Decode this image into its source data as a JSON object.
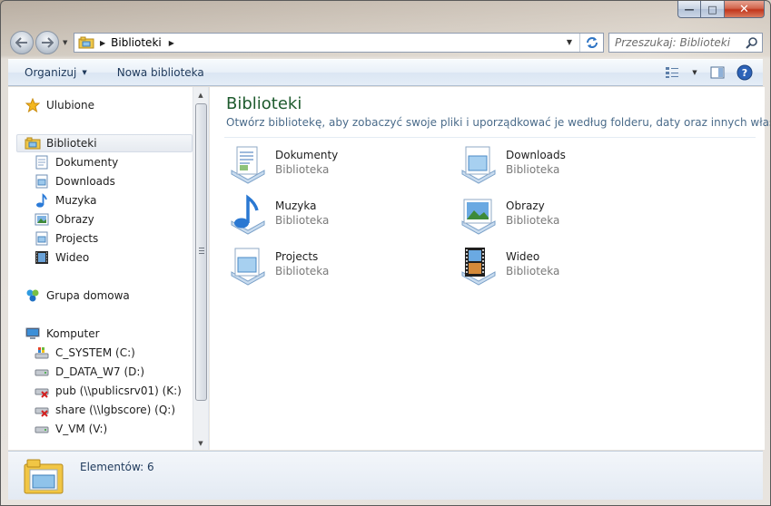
{
  "window": {
    "caption_buttons": {
      "minimize": "—",
      "maximize": "□",
      "close": "✕"
    }
  },
  "address_bar": {
    "breadcrumbs": [
      "Biblioteki"
    ],
    "search_placeholder": "Przeszukaj: Biblioteki"
  },
  "toolbar": {
    "organize_label": "Organizuj",
    "new_library_label": "Nowa biblioteka"
  },
  "navigation": {
    "favorites": "Ulubione",
    "libraries": "Biblioteki",
    "library_items": [
      "Dokumenty",
      "Downloads",
      "Muzyka",
      "Obrazy",
      "Projects",
      "Wideo"
    ],
    "homegroup": "Grupa domowa",
    "computer": "Komputer",
    "drives": [
      "C_SYSTEM (C:)",
      "D_DATA_W7 (D:)",
      "pub (\\\\publicsrv01) (K:)",
      "share (\\\\lgbscore) (Q:)",
      "V_VM (V:)"
    ]
  },
  "content": {
    "title": "Biblioteki",
    "subtitle": "Otwórz bibliotekę, aby zobaczyć swoje pliki i uporządkować je według folderu, daty oraz innych właściwo...",
    "libraries": [
      {
        "name": "Dokumenty",
        "type": "Biblioteka",
        "icon": "documents-library-icon"
      },
      {
        "name": "Downloads",
        "type": "Biblioteka",
        "icon": "generic-library-icon"
      },
      {
        "name": "Muzyka",
        "type": "Biblioteka",
        "icon": "music-library-icon"
      },
      {
        "name": "Obrazy",
        "type": "Biblioteka",
        "icon": "pictures-library-icon"
      },
      {
        "name": "Projects",
        "type": "Biblioteka",
        "icon": "projects-library-icon"
      },
      {
        "name": "Wideo",
        "type": "Biblioteka",
        "icon": "video-library-icon"
      }
    ]
  },
  "details": {
    "count_label": "Elementów: 6"
  },
  "colors": {
    "title_green": "#1e5b2e",
    "subtitle_blue": "#4a6b8a",
    "toolbar_text": "#1e395b"
  }
}
